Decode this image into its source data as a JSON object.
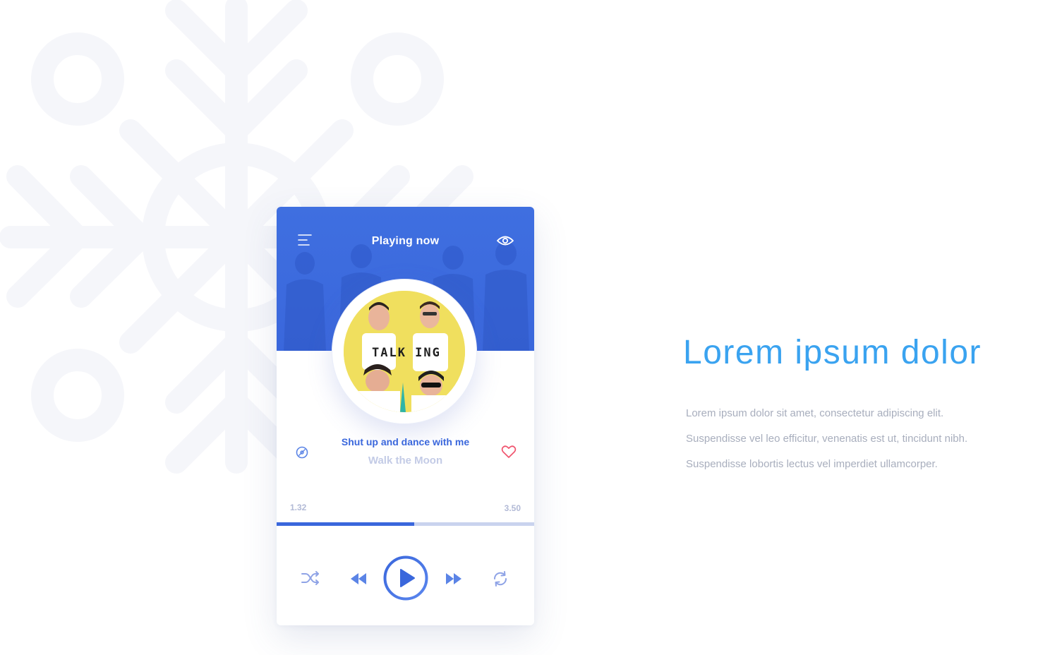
{
  "player": {
    "header": {
      "title": "Playing now",
      "menu_icon": "menu-icon",
      "view_icon": "eye-icon",
      "accent": "#3a67dc"
    },
    "track": {
      "title": "Shut up and dance with me",
      "artist": "Walk the Moon",
      "cover_text": "TALK ING"
    },
    "progress": {
      "elapsed": "1.32",
      "total": "3.50",
      "fraction": 0.535
    },
    "controls": {
      "shuffle_icon": "shuffle-icon",
      "prev_icon": "rewind-icon",
      "play_icon": "play-icon",
      "next_icon": "fast-forward-icon",
      "repeat_icon": "repeat-icon",
      "disc_icon": "disc-icon",
      "favorite_icon": "heart-icon",
      "favorite_color": "#f0546e"
    }
  },
  "hero": {
    "title": "Lorem ipsum dolor",
    "title_color": "#3aa3f0",
    "lines": [
      "Lorem ipsum dolor sit amet, consectetur adipiscing elit.",
      "Suspendisse vel leo efficitur, venenatis est ut, tincidunt nibh.",
      "Suspendisse lobortis lectus vel imperdiet ullamcorper."
    ]
  },
  "background": {
    "decoration": "snowflake-icon",
    "color": "#f5f6fa"
  }
}
